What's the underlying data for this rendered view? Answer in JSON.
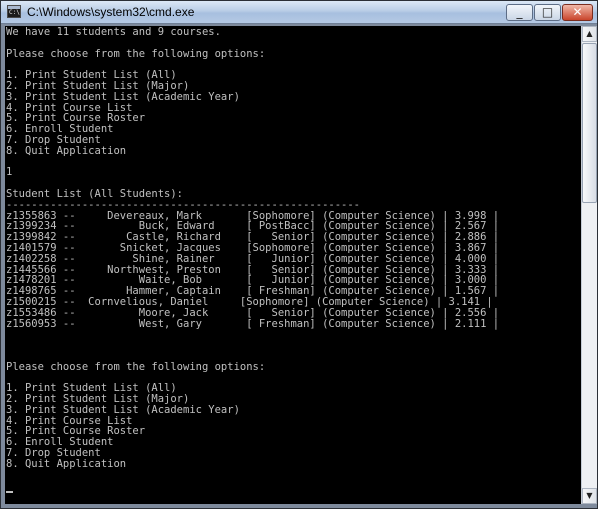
{
  "window": {
    "title": "C:\\Windows\\system32\\cmd.exe",
    "icon_text": "C:\\",
    "controls": {
      "minimize": "_",
      "maximize": "□",
      "close": "✕"
    }
  },
  "console": {
    "text": "We have 11 students and 9 courses.\n\nPlease choose from the following options:\n\n1. Print Student List (All)\n2. Print Student List (Major)\n3. Print Student List (Academic Year)\n4. Print Course List\n5. Print Course Roster\n6. Enroll Student\n7. Drop Student\n8. Quit Application\n\n1\n\nStudent List (All Students):\n--------------------------------------------------------\nz1355863 --     Devereaux, Mark       [Sophomore] (Computer Science) | 3.998 |\nz1399234 --          Buck, Edward     [ PostBacc] (Computer Science) | 2.567 |\nz1399842 --        Castle, Richard    [   Senior] (Computer Science) | 2.886 |\nz1401579 --       Snicket, Jacques    [Sophomore] (Computer Science) | 3.867 |\nz1402258 --         Shine, Rainer     [   Junior] (Computer Science) | 4.000 |\nz1445566 --     Northwest, Preston    [   Senior] (Computer Science) | 3.333 |\nz1478201 --          Waite, Bob       [   Junior] (Computer Science) | 3.000 |\nz1498765 --        Hammer, Captain    [ Freshman] (Computer Science) | 1.567 |\nz1500215 --  Cornvelious, Daniel     [Sophomore] (Computer Science) | 3.141 |\nz1553486 --          Moore, Jack      [   Senior] (Computer Science) | 2.556 |\nz1560953 --          West, Gary       [ Freshman] (Computer Science) | 2.111 |\n\n\n\nPlease choose from the following options:\n\n1. Print Student List (All)\n2. Print Student List (Major)\n3. Print Student List (Academic Year)\n4. Print Course List\n5. Print Course Roster\n6. Enroll Student\n7. Drop Student\n8. Quit Application\n"
  },
  "scrollbar": {
    "up": "▲",
    "down": "▼"
  },
  "colors": {
    "console_bg": "#000000",
    "console_fg": "#c0c0c0"
  }
}
